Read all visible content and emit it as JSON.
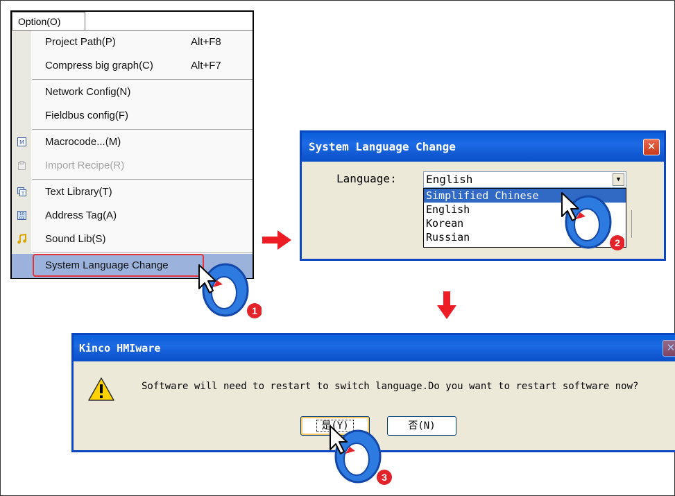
{
  "menu": {
    "title": "Option(O)",
    "items": [
      {
        "label": "Project Path(P)",
        "shortcut": "Alt+F8",
        "icon": "",
        "disabled": false
      },
      {
        "label": "Compress big graph(C)",
        "shortcut": "Alt+F7",
        "icon": "",
        "disabled": false
      },
      {
        "label": "Network Config(N)",
        "shortcut": "",
        "icon": "",
        "disabled": false
      },
      {
        "label": "Fieldbus config(F)",
        "shortcut": "",
        "icon": "",
        "disabled": false
      },
      {
        "label": "Macrocode...(M)",
        "shortcut": "",
        "icon": "macrocode-icon",
        "disabled": false
      },
      {
        "label": "Import Recipe(R)",
        "shortcut": "",
        "icon": "import-recipe-icon",
        "disabled": true
      },
      {
        "label": "Text Library(T)",
        "shortcut": "",
        "icon": "text-library-icon",
        "disabled": false
      },
      {
        "label": "Address Tag(A)",
        "shortcut": "",
        "icon": "address-tag-icon",
        "disabled": false
      },
      {
        "label": "Sound Lib(S)",
        "shortcut": "",
        "icon": "sound-lib-icon",
        "disabled": false
      },
      {
        "label": "System Language Change",
        "shortcut": "",
        "icon": "",
        "disabled": false
      }
    ]
  },
  "language_dialog": {
    "title": "System Language Change",
    "language_label": "Language:",
    "selected": "English",
    "options": [
      "Simplified Chinese",
      "English",
      "Korean",
      "Russian"
    ]
  },
  "restart_dialog": {
    "title": "Kinco HMIware",
    "message": "Software will need to restart to switch language.Do you want to restart software now?",
    "yes_label": "是(Y)",
    "no_label": "否(N)"
  },
  "steps": [
    "1",
    "2",
    "3"
  ],
  "colors": {
    "highlight_border": "#e4333a",
    "arrow": "#ee1c24",
    "title_blue": "#0a5fd8",
    "step_badge": "#e4222a"
  }
}
